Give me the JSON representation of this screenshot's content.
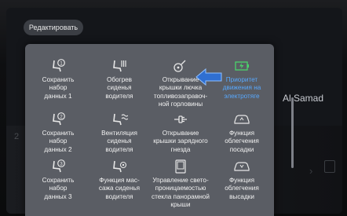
{
  "toolbar": {
    "edit_label": "Редактировать"
  },
  "background": {
    "profile_name": "Al Samad",
    "row_number": "2"
  },
  "menu": {
    "items": [
      {
        "label": "Сохранить\nнабор\nданных 1",
        "icon": "seat-memory-1-icon"
      },
      {
        "label": "Обогрев\nсиденья\nводителя",
        "icon": "seat-heating-icon"
      },
      {
        "label": "Открывание\nкрышки лючка\nтопливозаправоч-\nной горловины",
        "icon": "fuel-door-icon"
      },
      {
        "label": "Приоритет\nдвижения на\nэлектротяге",
        "icon": "ev-priority-icon",
        "highlight": true
      },
      {
        "label": "Сохранить\nнабор\nданных 2",
        "icon": "seat-memory-2-icon"
      },
      {
        "label": "Вентиляция\nсиденья\nводителя",
        "icon": "seat-ventilation-icon"
      },
      {
        "label": "Открывание\nкрышки зарядного\nгнезда",
        "icon": "charge-port-icon"
      },
      {
        "label": "Функция\nоблегчения\nпосадки",
        "icon": "easy-entry-icon"
      },
      {
        "label": "Сохранить\nнабор\nданных 3",
        "icon": "seat-memory-3-icon"
      },
      {
        "label": "Функция мас-\nсажа сиденья\nводителя",
        "icon": "seat-massage-icon"
      },
      {
        "label": "Управление свето-\nпроницаемостью\nстекла панорамной\nкрыши",
        "icon": "panoramic-roof-icon"
      },
      {
        "label": "Функция\nоблегчения\nвысадки",
        "icon": "easy-exit-icon"
      }
    ]
  },
  "colors": {
    "highlight": "#58a9ff",
    "arrow": "#2f6fd1",
    "panel": "#5a5d64"
  }
}
